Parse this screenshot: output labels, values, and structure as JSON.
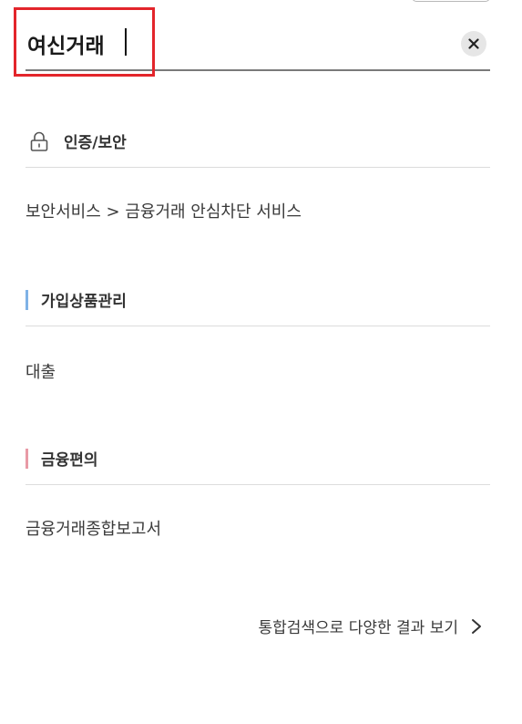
{
  "search": {
    "query": "여신거래"
  },
  "sections": [
    {
      "title": "인증/보안",
      "icon": "lock-icon",
      "results": [
        "보안서비스 > 금융거래 안심차단 서비스"
      ]
    },
    {
      "title": "가입상품관리",
      "accent_color": "#7fb2e6",
      "results": [
        "대출"
      ]
    },
    {
      "title": "금융편의",
      "accent_color": "#e89aa6",
      "results": [
        "금융거래종합보고서"
      ]
    }
  ],
  "more_link": {
    "label": "통합검색으로 다양한 결과 보기"
  }
}
